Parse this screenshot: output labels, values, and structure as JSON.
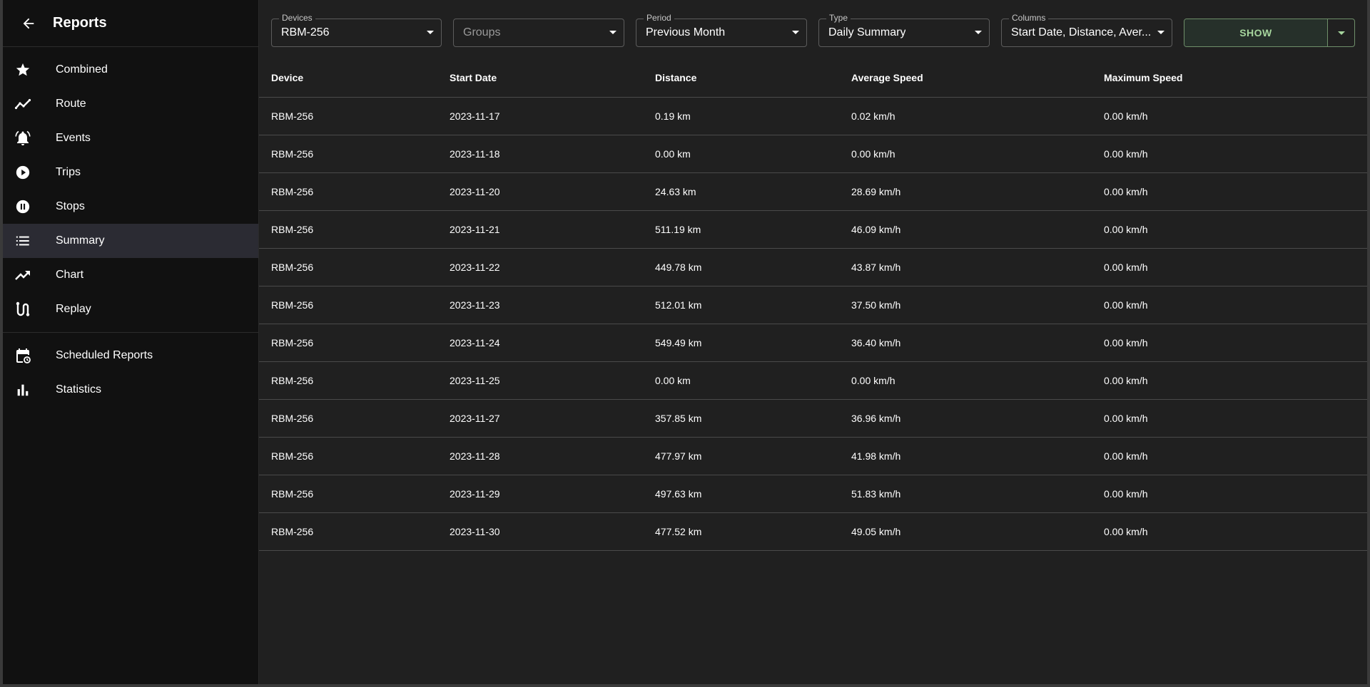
{
  "sidebar": {
    "title": "Reports",
    "items": [
      {
        "label": "Combined",
        "icon": "star-icon",
        "selected": false
      },
      {
        "label": "Route",
        "icon": "timeline-icon",
        "selected": false
      },
      {
        "label": "Events",
        "icon": "bell-alarm-icon",
        "selected": false
      },
      {
        "label": "Trips",
        "icon": "play-circle-icon",
        "selected": false
      },
      {
        "label": "Stops",
        "icon": "pause-circle-icon",
        "selected": false
      },
      {
        "label": "Summary",
        "icon": "list-icon",
        "selected": true
      },
      {
        "label": "Chart",
        "icon": "trending-up-icon",
        "selected": false
      },
      {
        "label": "Replay",
        "icon": "route-icon",
        "selected": false
      }
    ],
    "secondary": [
      {
        "label": "Scheduled Reports",
        "icon": "calendar-refresh-icon"
      },
      {
        "label": "Statistics",
        "icon": "bar-chart-icon"
      }
    ]
  },
  "toolbar": {
    "devices": {
      "label": "Devices",
      "value": "RBM-256"
    },
    "groups": {
      "label": "",
      "value": "Groups"
    },
    "period": {
      "label": "Period",
      "value": "Previous Month"
    },
    "type": {
      "label": "Type",
      "value": "Daily Summary"
    },
    "columns": {
      "label": "Columns",
      "value": "Start Date, Distance, Aver..."
    },
    "show_label": "SHOW"
  },
  "table": {
    "headers": [
      "Device",
      "Start Date",
      "Distance",
      "Average Speed",
      "Maximum Speed"
    ],
    "rows": [
      [
        "RBM-256",
        "2023-11-17",
        "0.19 km",
        "0.02 km/h",
        "0.00 km/h"
      ],
      [
        "RBM-256",
        "2023-11-18",
        "0.00 km",
        "0.00 km/h",
        "0.00 km/h"
      ],
      [
        "RBM-256",
        "2023-11-20",
        "24.63 km",
        "28.69 km/h",
        "0.00 km/h"
      ],
      [
        "RBM-256",
        "2023-11-21",
        "511.19 km",
        "46.09 km/h",
        "0.00 km/h"
      ],
      [
        "RBM-256",
        "2023-11-22",
        "449.78 km",
        "43.87 km/h",
        "0.00 km/h"
      ],
      [
        "RBM-256",
        "2023-11-23",
        "512.01 km",
        "37.50 km/h",
        "0.00 km/h"
      ],
      [
        "RBM-256",
        "2023-11-24",
        "549.49 km",
        "36.40 km/h",
        "0.00 km/h"
      ],
      [
        "RBM-256",
        "2023-11-25",
        "0.00 km",
        "0.00 km/h",
        "0.00 km/h"
      ],
      [
        "RBM-256",
        "2023-11-27",
        "357.85 km",
        "36.96 km/h",
        "0.00 km/h"
      ],
      [
        "RBM-256",
        "2023-11-28",
        "477.97 km",
        "41.98 km/h",
        "0.00 km/h"
      ],
      [
        "RBM-256",
        "2023-11-29",
        "497.63 km",
        "51.83 km/h",
        "0.00 km/h"
      ],
      [
        "RBM-256",
        "2023-11-30",
        "477.52 km",
        "49.05 km/h",
        "0.00 km/h"
      ]
    ]
  },
  "colors": {
    "accent": "#a6d59d",
    "sidebar_bg": "#111111",
    "main_bg": "#202020",
    "selected_bg": "#2b2b33"
  }
}
